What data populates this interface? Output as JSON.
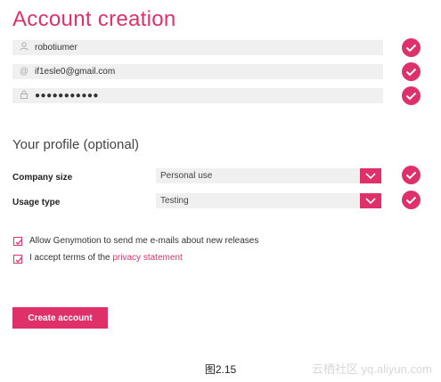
{
  "form": {
    "title": "Account creation",
    "username_icon": "person-icon",
    "username": "robotiumer",
    "email_icon": "at-icon",
    "email": "if1esle0@gmail.com",
    "password_icon": "lock-icon",
    "password_mask": "●●●●●●●●●●●",
    "profile_title": "Your profile (optional)",
    "company_size_label": "Company size",
    "company_size_value": "Personal use",
    "usage_type_label": "Usage type",
    "usage_type_value": "Testing",
    "newsletter_label": "Allow Genymotion to send me e-mails about new releases",
    "newsletter_checked": true,
    "terms_prefix": "I accept terms of the ",
    "terms_link": "privacy statement",
    "terms_checked": true,
    "submit_label": "Create account"
  },
  "caption": "图2.15",
  "watermark": "云栖社区 yq.aliyun.com",
  "colors": {
    "accent": "#e0306a",
    "field_bg": "#f0f0f0"
  }
}
